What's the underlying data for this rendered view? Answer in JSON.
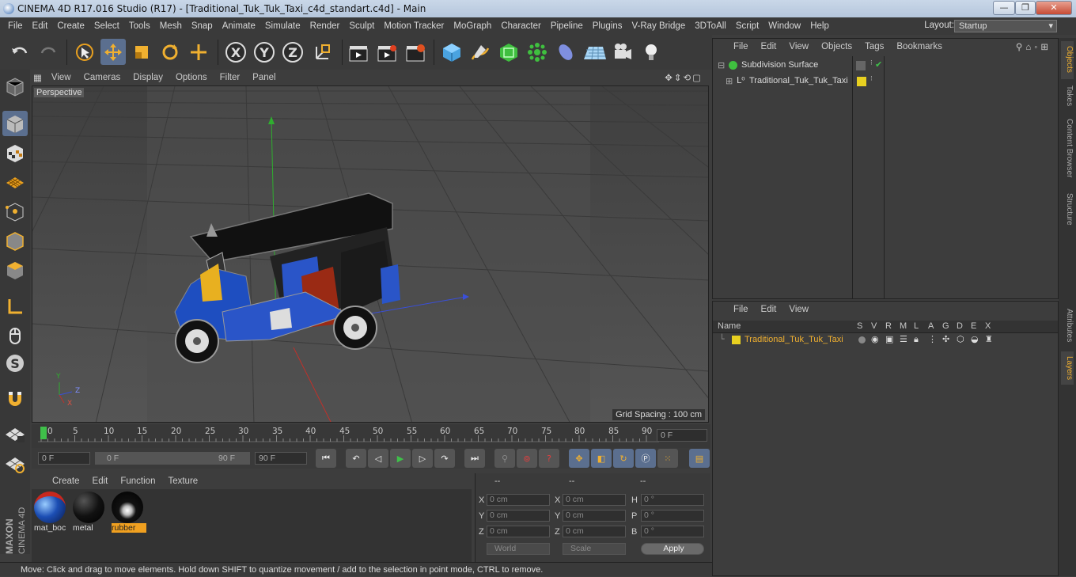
{
  "window": {
    "title": "CINEMA 4D R17.016 Studio (R17) - [Traditional_Tuk_Tuk_Taxi_c4d_standart.c4d] - Main",
    "minimize": "—",
    "maximize": "❐",
    "close": "✕"
  },
  "menubar": [
    "File",
    "Edit",
    "Create",
    "Select",
    "Tools",
    "Mesh",
    "Snap",
    "Animate",
    "Simulate",
    "Render",
    "Sculpt",
    "Motion Tracker",
    "MoGraph",
    "Character",
    "Pipeline",
    "Plugins",
    "V-Ray Bridge",
    "3DToAll",
    "Script",
    "Window",
    "Help"
  ],
  "layout": {
    "label": "Layout:",
    "value": "Startup"
  },
  "viewport": {
    "menu": [
      "View",
      "Cameras",
      "Display",
      "Options",
      "Filter",
      "Panel"
    ],
    "name": "Perspective",
    "grid_spacing": "Grid Spacing : 100 cm",
    "axis_x": "X",
    "axis_y": "Y",
    "axis_z": "Z"
  },
  "timeline": {
    "ticks": [
      "0",
      "5",
      "10",
      "15",
      "20",
      "25",
      "30",
      "35",
      "40",
      "45",
      "50",
      "55",
      "60",
      "65",
      "70",
      "75",
      "80",
      "85",
      "90"
    ],
    "current_frame": "0 F"
  },
  "transport": {
    "start": "0 F",
    "range_start": "0 F",
    "range_end": "90 F",
    "end": "90 F"
  },
  "materials": {
    "menu": [
      "Create",
      "Edit",
      "Function",
      "Texture"
    ],
    "items": [
      {
        "label": "mat_boc"
      },
      {
        "label": "metal"
      },
      {
        "label": "rubber"
      }
    ]
  },
  "coords": {
    "headers": [
      "--",
      "--",
      "--"
    ],
    "x_label": "X",
    "y_label": "Y",
    "z_label": "Z",
    "h_label": "H",
    "p_label": "P",
    "b_label": "B",
    "pos_x": "0 cm",
    "pos_y": "0 cm",
    "pos_z": "0 cm",
    "size_x": "0 cm",
    "size_y": "0 cm",
    "size_z": "0 cm",
    "rot_h": "0 °",
    "rot_p": "0 °",
    "rot_b": "0 °",
    "world": "World",
    "scale": "Scale",
    "apply": "Apply"
  },
  "object_manager": {
    "menu": [
      "File",
      "Edit",
      "View",
      "Objects",
      "Tags",
      "Bookmarks"
    ],
    "objects": [
      {
        "name": "Subdivision Surface"
      },
      {
        "name": "Traditional_Tuk_Tuk_Taxi"
      }
    ]
  },
  "layer_manager": {
    "menu": [
      "File",
      "Edit",
      "View"
    ],
    "columns": [
      "Name",
      "S",
      "V",
      "R",
      "M",
      "L",
      "A",
      "G",
      "D",
      "E",
      "X"
    ],
    "layers": [
      {
        "name": "Traditional_Tuk_Tuk_Taxi"
      }
    ]
  },
  "right_tabs": [
    "Objects",
    "Takes",
    "Content Browser",
    "Structure",
    "Attributes",
    "Layers"
  ],
  "status": "Move: Click and drag to move elements. Hold down SHIFT to quantize movement / add to the selection in point mode, CTRL to remove.",
  "brand": {
    "maxon": "MAXON",
    "cinema": "CINEMA 4D"
  },
  "colors": {
    "accent": "#5b6f8f",
    "selected_text": "#f0b030",
    "layer_yellow": "#e8d020"
  }
}
